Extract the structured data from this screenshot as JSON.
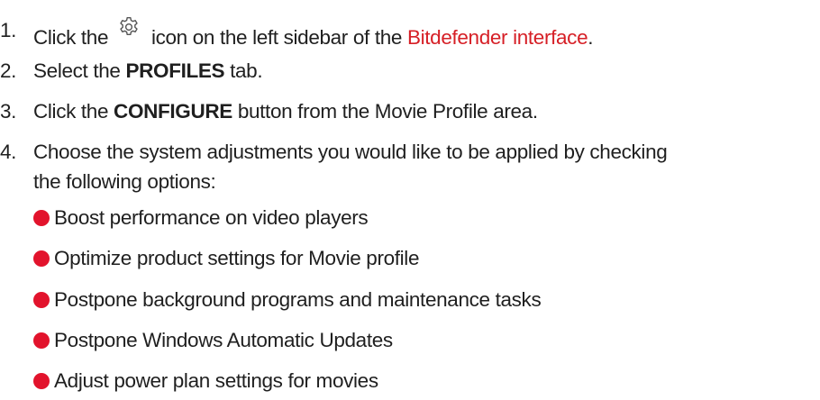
{
  "steps": [
    {
      "number": "1.",
      "before_icon": "Click the",
      "icon": "gear-icon",
      "after_icon": "icon on the left sidebar of the",
      "link_text": "Bitdefender interface",
      "end": "."
    },
    {
      "number": "2.",
      "before": "Select the",
      "bold": "PROFILES",
      "after": "tab."
    },
    {
      "number": "3.",
      "before": "Click the",
      "bold": "CONFIGURE",
      "after": "button from the Movie Profile area."
    },
    {
      "number": "4.",
      "line1": "Choose the system adjustments you would like to be applied by checking",
      "line2": "the following options:"
    }
  ],
  "options": [
    "Boost performance on video players",
    "Optimize product settings for Movie profile",
    "Postpone background programs and maintenance tasks",
    "Postpone Windows Automatic Updates",
    "Adjust power plan settings for movies"
  ],
  "colors": {
    "link": "#d61f26",
    "bullet": "#e2132c",
    "text": "#1f1f1f"
  }
}
